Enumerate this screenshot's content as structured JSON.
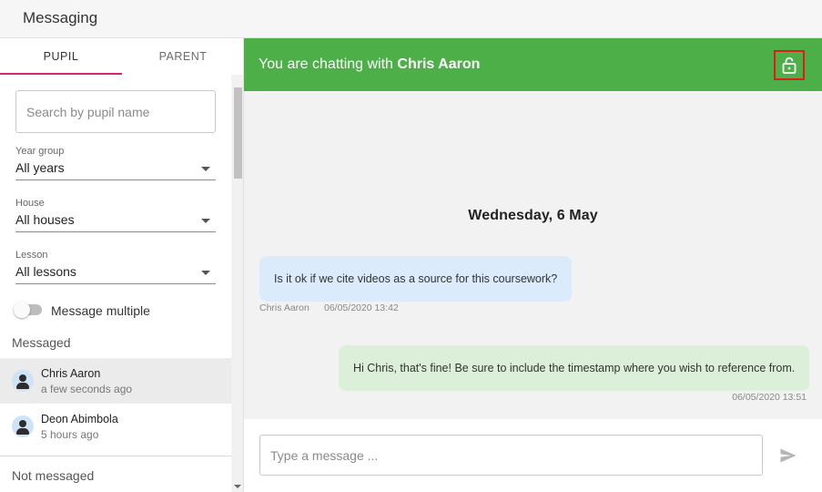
{
  "app": {
    "title": "Messaging"
  },
  "tabs": [
    {
      "label": "PUPIL",
      "active": true
    },
    {
      "label": "PARENT",
      "active": false
    }
  ],
  "search": {
    "placeholder": "Search by pupil name",
    "value": ""
  },
  "filters": {
    "year_group": {
      "label": "Year group",
      "value": "All years"
    },
    "house": {
      "label": "House",
      "value": "All houses"
    },
    "lesson": {
      "label": "Lesson",
      "value": "All lessons"
    }
  },
  "message_multiple": {
    "label": "Message multiple",
    "enabled": false
  },
  "sections": {
    "messaged": "Messaged",
    "not_messaged": "Not messaged"
  },
  "contacts": [
    {
      "name": "Chris Aaron",
      "time": "a few seconds ago",
      "active": true
    },
    {
      "name": "Deon Abimbola",
      "time": "5 hours ago",
      "active": false
    }
  ],
  "chat": {
    "header_prefix": "You are chatting with",
    "header_name": "Chris Aaron",
    "header_color": "#4caf47",
    "lock_icon": "unlock-icon",
    "date": "Wednesday, 6 May",
    "messages": [
      {
        "direction": "incoming",
        "text": "Is it ok if we cite videos as a source for this coursework?",
        "sender": "Chris Aaron",
        "time": "06/05/2020 13:42"
      },
      {
        "direction": "outgoing",
        "text": "Hi Chris, that's fine! Be sure to include the timestamp where you wish to reference from.",
        "time": "06/05/2020 13:51"
      }
    ]
  },
  "composer": {
    "placeholder": "Type a message ...",
    "send_icon": "send-icon"
  },
  "colors": {
    "accent": "#d6246e",
    "incoming_bubble": "#dcebfb",
    "outgoing_bubble": "#dcefd9"
  }
}
